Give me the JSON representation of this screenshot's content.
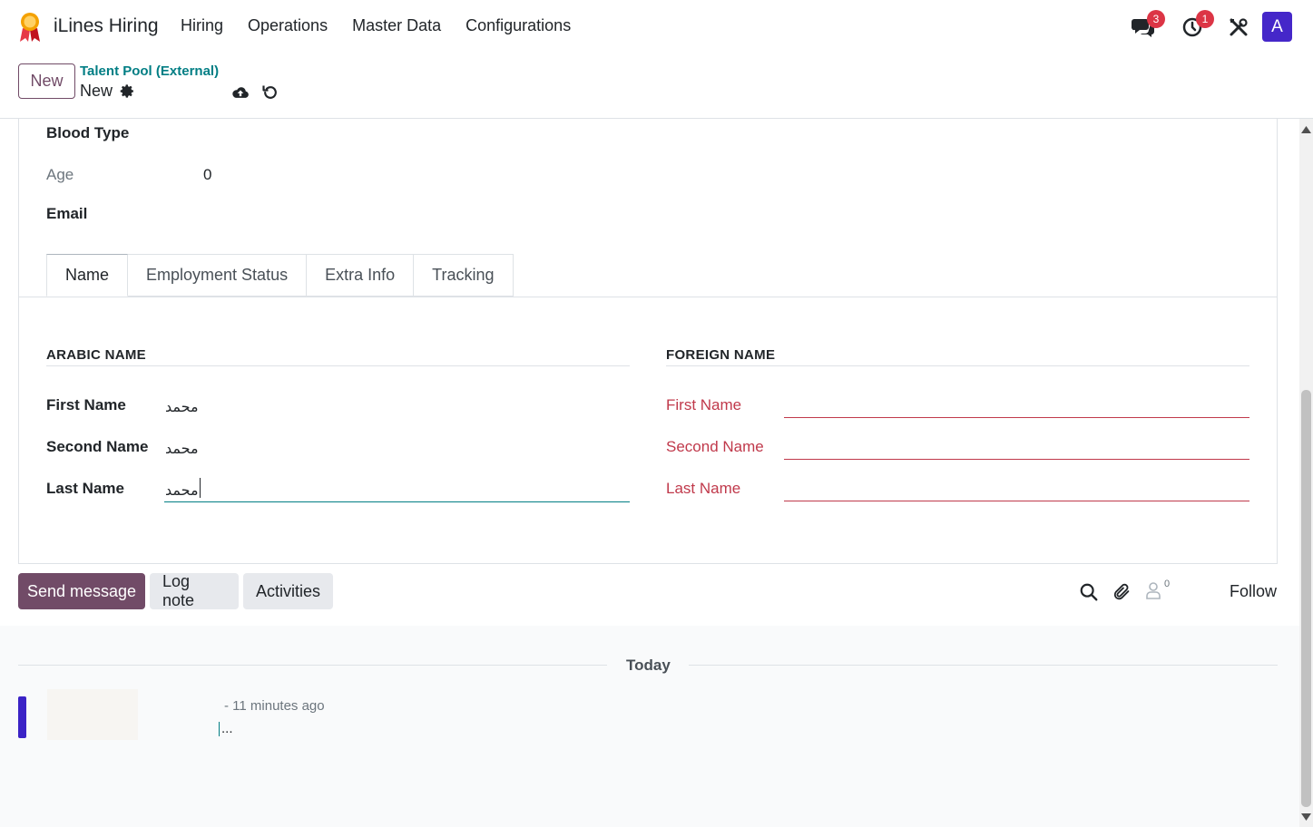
{
  "navbar": {
    "app_name": "iLines Hiring",
    "menu": [
      "Hiring",
      "Operations",
      "Master Data",
      "Configurations"
    ],
    "messages_badge": "3",
    "activities_badge": "1",
    "avatar_letter": "A"
  },
  "control": {
    "new_label": "New",
    "breadcrumb_parent": "Talent Pool (External)",
    "breadcrumb_current": "New"
  },
  "form": {
    "blood_type_label": "Blood Type",
    "age_label": "Age",
    "age_value": "0",
    "email_label": "Email",
    "tabs": [
      "Name",
      "Employment Status",
      "Extra Info",
      "Tracking"
    ],
    "active_tab": "Name",
    "arabic": {
      "title": "ARABIC NAME",
      "first_label": "First Name",
      "first_value": "محمد",
      "second_label": "Second Name",
      "second_value": "محمد",
      "last_label": "Last Name",
      "last_value": "محمد"
    },
    "foreign": {
      "title": "FOREIGN NAME",
      "first_label": "First Name",
      "second_label": "Second Name",
      "last_label": "Last Name"
    }
  },
  "chatter": {
    "send_message": "Send message",
    "log_note": "Log note",
    "activities": "Activities",
    "followers_count": "0",
    "follow": "Follow",
    "today": "Today",
    "message_time": "- 11 minutes ago",
    "message_body": "..."
  },
  "colors": {
    "primary": "#714b67",
    "link": "#017e84",
    "required": "#c0394b",
    "badge": "#dc3545",
    "avatar": "#4527c9"
  }
}
